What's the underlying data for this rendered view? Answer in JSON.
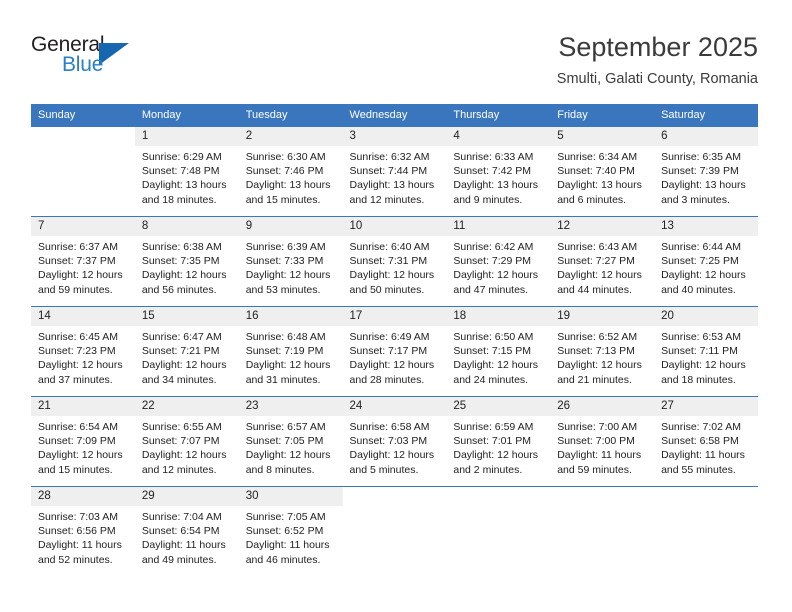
{
  "logo": {
    "word_general": "General",
    "word_blue": "Blue",
    "triangle_color": "#1666b0",
    "blue_color": "#2a7fc9"
  },
  "header": {
    "month_title": "September 2025",
    "location": "Smulti, Galati County, Romania"
  },
  "theme": {
    "header_blue": "#3a76bd",
    "daynum_band": "#efefef",
    "text": "#222222"
  },
  "weekdays": [
    "Sunday",
    "Monday",
    "Tuesday",
    "Wednesday",
    "Thursday",
    "Friday",
    "Saturday"
  ],
  "weeks": [
    [
      {
        "day": "",
        "lines": []
      },
      {
        "day": "1",
        "lines": [
          "Sunrise: 6:29 AM",
          "Sunset: 7:48 PM",
          "Daylight: 13 hours",
          "and 18 minutes."
        ]
      },
      {
        "day": "2",
        "lines": [
          "Sunrise: 6:30 AM",
          "Sunset: 7:46 PM",
          "Daylight: 13 hours",
          "and 15 minutes."
        ]
      },
      {
        "day": "3",
        "lines": [
          "Sunrise: 6:32 AM",
          "Sunset: 7:44 PM",
          "Daylight: 13 hours",
          "and 12 minutes."
        ]
      },
      {
        "day": "4",
        "lines": [
          "Sunrise: 6:33 AM",
          "Sunset: 7:42 PM",
          "Daylight: 13 hours",
          "and 9 minutes."
        ]
      },
      {
        "day": "5",
        "lines": [
          "Sunrise: 6:34 AM",
          "Sunset: 7:40 PM",
          "Daylight: 13 hours",
          "and 6 minutes."
        ]
      },
      {
        "day": "6",
        "lines": [
          "Sunrise: 6:35 AM",
          "Sunset: 7:39 PM",
          "Daylight: 13 hours",
          "and 3 minutes."
        ]
      }
    ],
    [
      {
        "day": "7",
        "lines": [
          "Sunrise: 6:37 AM",
          "Sunset: 7:37 PM",
          "Daylight: 12 hours",
          "and 59 minutes."
        ]
      },
      {
        "day": "8",
        "lines": [
          "Sunrise: 6:38 AM",
          "Sunset: 7:35 PM",
          "Daylight: 12 hours",
          "and 56 minutes."
        ]
      },
      {
        "day": "9",
        "lines": [
          "Sunrise: 6:39 AM",
          "Sunset: 7:33 PM",
          "Daylight: 12 hours",
          "and 53 minutes."
        ]
      },
      {
        "day": "10",
        "lines": [
          "Sunrise: 6:40 AM",
          "Sunset: 7:31 PM",
          "Daylight: 12 hours",
          "and 50 minutes."
        ]
      },
      {
        "day": "11",
        "lines": [
          "Sunrise: 6:42 AM",
          "Sunset: 7:29 PM",
          "Daylight: 12 hours",
          "and 47 minutes."
        ]
      },
      {
        "day": "12",
        "lines": [
          "Sunrise: 6:43 AM",
          "Sunset: 7:27 PM",
          "Daylight: 12 hours",
          "and 44 minutes."
        ]
      },
      {
        "day": "13",
        "lines": [
          "Sunrise: 6:44 AM",
          "Sunset: 7:25 PM",
          "Daylight: 12 hours",
          "and 40 minutes."
        ]
      }
    ],
    [
      {
        "day": "14",
        "lines": [
          "Sunrise: 6:45 AM",
          "Sunset: 7:23 PM",
          "Daylight: 12 hours",
          "and 37 minutes."
        ]
      },
      {
        "day": "15",
        "lines": [
          "Sunrise: 6:47 AM",
          "Sunset: 7:21 PM",
          "Daylight: 12 hours",
          "and 34 minutes."
        ]
      },
      {
        "day": "16",
        "lines": [
          "Sunrise: 6:48 AM",
          "Sunset: 7:19 PM",
          "Daylight: 12 hours",
          "and 31 minutes."
        ]
      },
      {
        "day": "17",
        "lines": [
          "Sunrise: 6:49 AM",
          "Sunset: 7:17 PM",
          "Daylight: 12 hours",
          "and 28 minutes."
        ]
      },
      {
        "day": "18",
        "lines": [
          "Sunrise: 6:50 AM",
          "Sunset: 7:15 PM",
          "Daylight: 12 hours",
          "and 24 minutes."
        ]
      },
      {
        "day": "19",
        "lines": [
          "Sunrise: 6:52 AM",
          "Sunset: 7:13 PM",
          "Daylight: 12 hours",
          "and 21 minutes."
        ]
      },
      {
        "day": "20",
        "lines": [
          "Sunrise: 6:53 AM",
          "Sunset: 7:11 PM",
          "Daylight: 12 hours",
          "and 18 minutes."
        ]
      }
    ],
    [
      {
        "day": "21",
        "lines": [
          "Sunrise: 6:54 AM",
          "Sunset: 7:09 PM",
          "Daylight: 12 hours",
          "and 15 minutes."
        ]
      },
      {
        "day": "22",
        "lines": [
          "Sunrise: 6:55 AM",
          "Sunset: 7:07 PM",
          "Daylight: 12 hours",
          "and 12 minutes."
        ]
      },
      {
        "day": "23",
        "lines": [
          "Sunrise: 6:57 AM",
          "Sunset: 7:05 PM",
          "Daylight: 12 hours",
          "and 8 minutes."
        ]
      },
      {
        "day": "24",
        "lines": [
          "Sunrise: 6:58 AM",
          "Sunset: 7:03 PM",
          "Daylight: 12 hours",
          "and 5 minutes."
        ]
      },
      {
        "day": "25",
        "lines": [
          "Sunrise: 6:59 AM",
          "Sunset: 7:01 PM",
          "Daylight: 12 hours",
          "and 2 minutes."
        ]
      },
      {
        "day": "26",
        "lines": [
          "Sunrise: 7:00 AM",
          "Sunset: 7:00 PM",
          "Daylight: 11 hours",
          "and 59 minutes."
        ]
      },
      {
        "day": "27",
        "lines": [
          "Sunrise: 7:02 AM",
          "Sunset: 6:58 PM",
          "Daylight: 11 hours",
          "and 55 minutes."
        ]
      }
    ],
    [
      {
        "day": "28",
        "lines": [
          "Sunrise: 7:03 AM",
          "Sunset: 6:56 PM",
          "Daylight: 11 hours",
          "and 52 minutes."
        ]
      },
      {
        "day": "29",
        "lines": [
          "Sunrise: 7:04 AM",
          "Sunset: 6:54 PM",
          "Daylight: 11 hours",
          "and 49 minutes."
        ]
      },
      {
        "day": "30",
        "lines": [
          "Sunrise: 7:05 AM",
          "Sunset: 6:52 PM",
          "Daylight: 11 hours",
          "and 46 minutes."
        ]
      },
      {
        "day": "",
        "lines": []
      },
      {
        "day": "",
        "lines": []
      },
      {
        "day": "",
        "lines": []
      },
      {
        "day": "",
        "lines": []
      }
    ]
  ]
}
